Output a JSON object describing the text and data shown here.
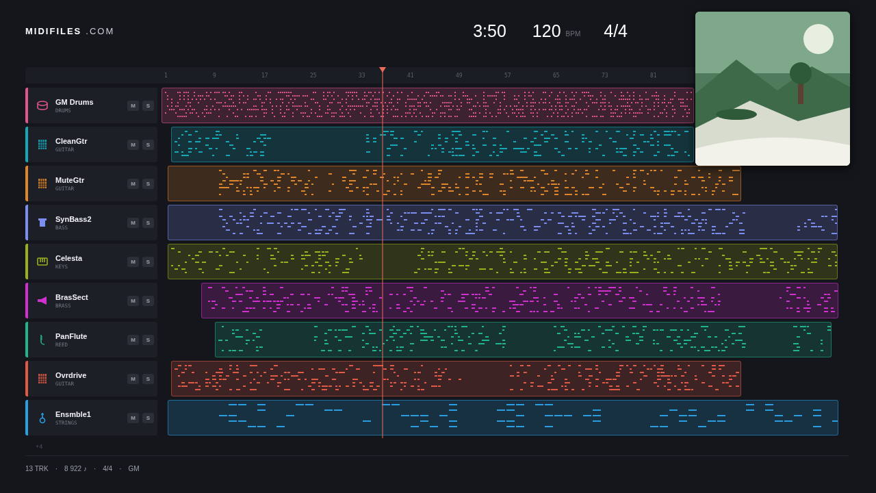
{
  "header": {
    "logo": "MIDIFILES",
    "logo_suffix": ".COM",
    "time": "3:50",
    "tempo": "120",
    "tempo_unit": "BPM",
    "meter": "4/4"
  },
  "ruler": {
    "ticks": [
      "1",
      "9",
      "17",
      "25",
      "33",
      "41",
      "49",
      "57",
      "65",
      "73",
      "81"
    ]
  },
  "tracks": [
    {
      "name": "GM Drums",
      "category": "DRUMS",
      "kind": "drums",
      "color": "#e0558a",
      "mute": "M",
      "solo": "S"
    },
    {
      "name": "CleanGtr",
      "category": "GUITAR",
      "kind": "guitar",
      "color": "#17a8b8",
      "mute": "M",
      "solo": "S"
    },
    {
      "name": "MuteGtr",
      "category": "GUITAR",
      "kind": "guitar",
      "color": "#e0862a",
      "mute": "M",
      "solo": "S"
    },
    {
      "name": "SynBass2",
      "category": "BASS",
      "kind": "bass",
      "color": "#7b8ef0",
      "mute": "M",
      "solo": "S"
    },
    {
      "name": "Celesta",
      "category": "KEYS",
      "kind": "keys",
      "color": "#9bb01c",
      "mute": "M",
      "solo": "S"
    },
    {
      "name": "BrasSect",
      "category": "BRASS",
      "kind": "brass",
      "color": "#d030d0",
      "mute": "M",
      "solo": "S"
    },
    {
      "name": "PanFlute",
      "category": "REED",
      "kind": "reed",
      "color": "#1fb58f",
      "mute": "M",
      "solo": "S"
    },
    {
      "name": "Ovrdrive",
      "category": "GUITAR",
      "kind": "guitar",
      "color": "#e05a45",
      "mute": "M",
      "solo": "S"
    },
    {
      "name": "Ensmble1",
      "category": "STRINGS",
      "kind": "strings",
      "color": "#2a9ee0",
      "mute": "M",
      "solo": "S"
    }
  ],
  "more_tracks": "+4",
  "status_bar": [
    "13 TRK",
    "·",
    "8 922 ♪",
    "·",
    "4/4",
    "·",
    "GM"
  ]
}
